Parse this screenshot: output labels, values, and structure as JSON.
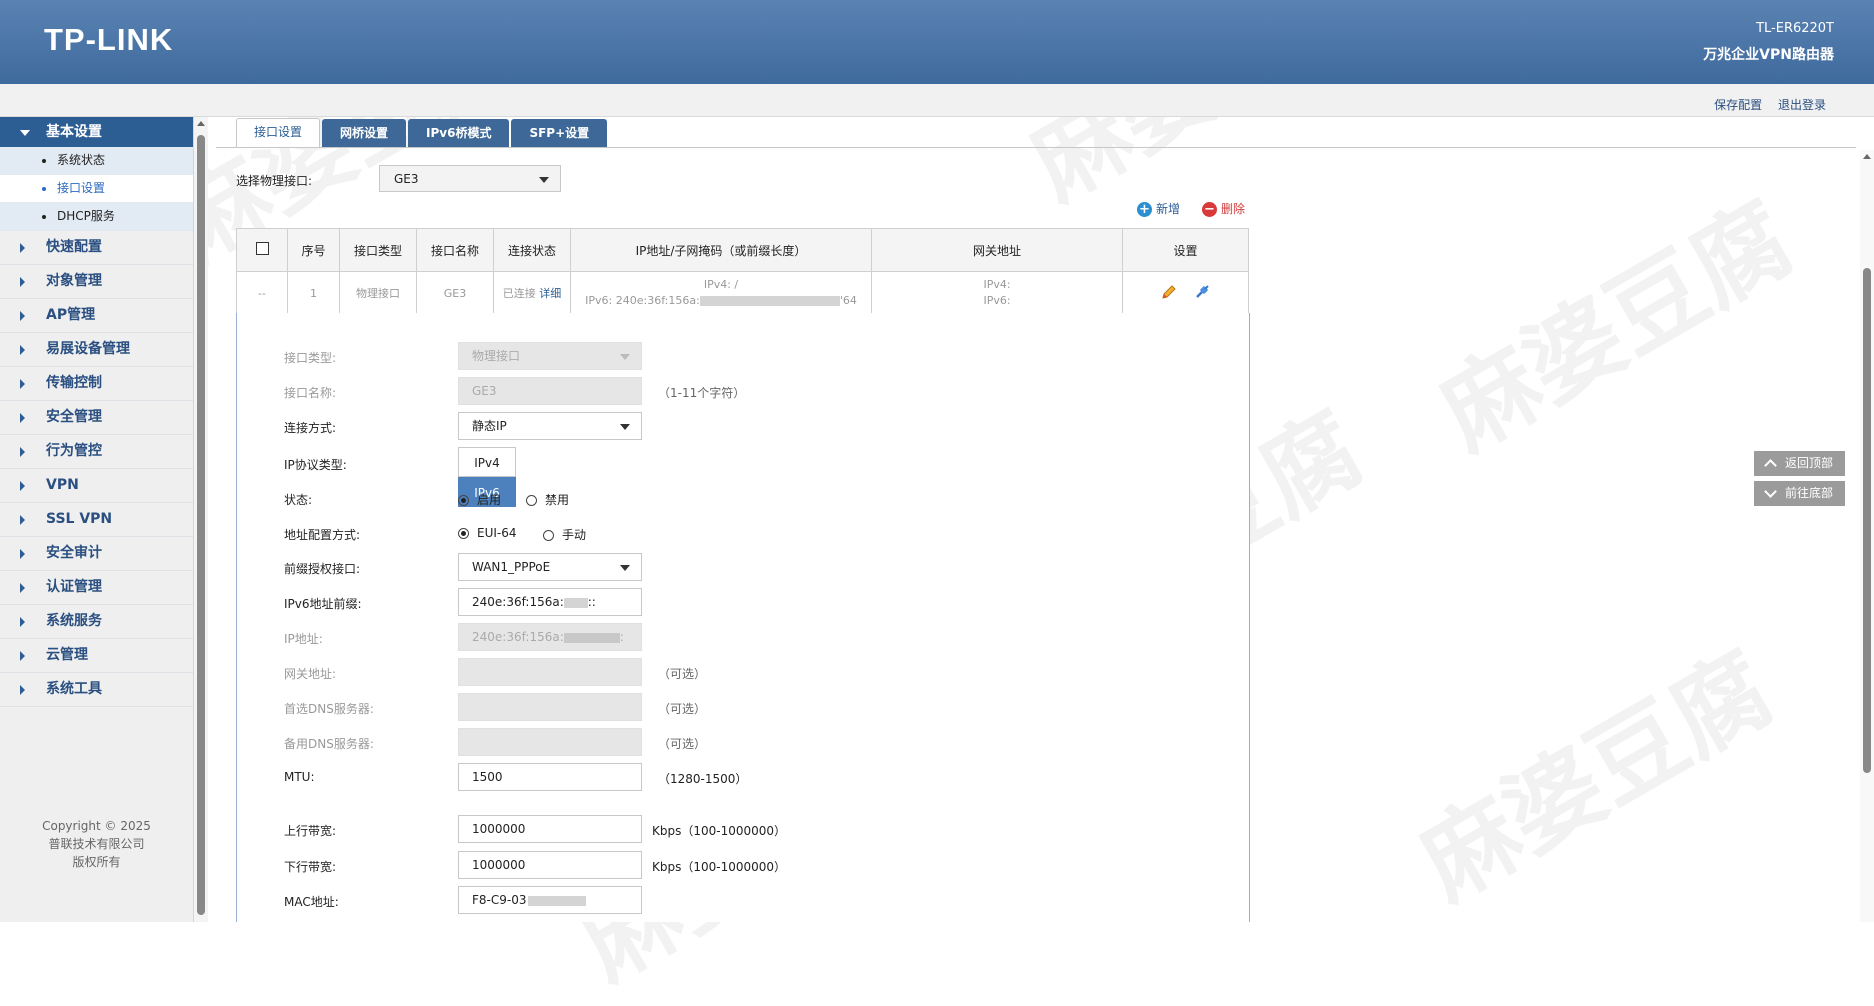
{
  "header": {
    "logo": "TP-LINK",
    "model": "TL-ER6220T",
    "model_desc": "万兆企业VPN路由器"
  },
  "toplinks": {
    "save": "保存配置",
    "logout": "退出登录"
  },
  "sidebar": {
    "head": "基本设置",
    "subitems": [
      "系统状态",
      "接口设置",
      "DHCP服务"
    ],
    "items": [
      "快速配置",
      "对象管理",
      "AP管理",
      "易展设备管理",
      "传输控制",
      "安全管理",
      "行为管控",
      "VPN",
      "SSL VPN",
      "安全审计",
      "认证管理",
      "系统服务",
      "云管理",
      "系统工具"
    ],
    "copyright": [
      "Copyright © 2025",
      "普联技术有限公司",
      "版权所有"
    ]
  },
  "tabs": [
    "接口设置",
    "网桥设置",
    "IPv6桥模式",
    "SFP+设置"
  ],
  "select": {
    "label": "选择物理接口:",
    "value": "GE3"
  },
  "actions": {
    "add": "新增",
    "delete": "删除"
  },
  "table": {
    "headers": [
      "序号",
      "接口类型",
      "接口名称",
      "连接状态",
      "IP地址/子网掩码（或前缀长度）",
      "网关地址",
      "设置"
    ],
    "row": {
      "dash": "--",
      "index": "1",
      "type": "物理接口",
      "name": "GE3",
      "status": "已连接",
      "detail": "详细",
      "ip_v4": "IPv4:  /",
      "ip_v6_prefix": "IPv6:  240e:36f:156a:",
      "ip_v6_suffix": "'64",
      "gw_v4": "IPv4:",
      "gw_v6": "IPv6:"
    }
  },
  "form": {
    "iface_type": {
      "label": "接口类型:",
      "value": "物理接口"
    },
    "iface_name": {
      "label": "接口名称:",
      "value": "GE3",
      "hint": "（1-11个字符）"
    },
    "conn_mode": {
      "label": "连接方式:",
      "value": "静态IP"
    },
    "ip_proto": {
      "label": "IP协议类型:",
      "opt1": "IPv4",
      "opt2": "IPv6"
    },
    "state": {
      "label": "状态:",
      "opt1": "启用",
      "opt2": "禁用"
    },
    "addr_mode": {
      "label": "地址配置方式:",
      "opt1": "EUI-64",
      "opt2": "手动"
    },
    "prefix_iface": {
      "label": "前缀授权接口:",
      "value": "WAN1_PPPoE"
    },
    "ipv6_prefix": {
      "label": "IPv6地址前缀:",
      "value": "240e:36f:156a:",
      "suffix": "::"
    },
    "ip_addr": {
      "label": "IP地址:",
      "value": "240e:36f:156a:",
      "suffix": ":"
    },
    "gateway": {
      "label": "网关地址:",
      "hint": "（可选）"
    },
    "dns1": {
      "label": "首选DNS服务器:",
      "hint": "（可选）"
    },
    "dns2": {
      "label": "备用DNS服务器:",
      "hint": "（可选）"
    },
    "mtu": {
      "label": "MTU:",
      "value": "1500",
      "hint": "（1280-1500）"
    },
    "up_bw": {
      "label": "上行带宽:",
      "value": "1000000",
      "hint": "Kbps（100-1000000）"
    },
    "down_bw": {
      "label": "下行带宽:",
      "value": "1000000",
      "hint": "Kbps（100-1000000）"
    },
    "mac": {
      "label": "MAC地址:",
      "value": "F8-C9-03"
    }
  },
  "float": {
    "top": "返回顶部",
    "bottom": "前往底部"
  },
  "watermark": "麻婆豆腐"
}
